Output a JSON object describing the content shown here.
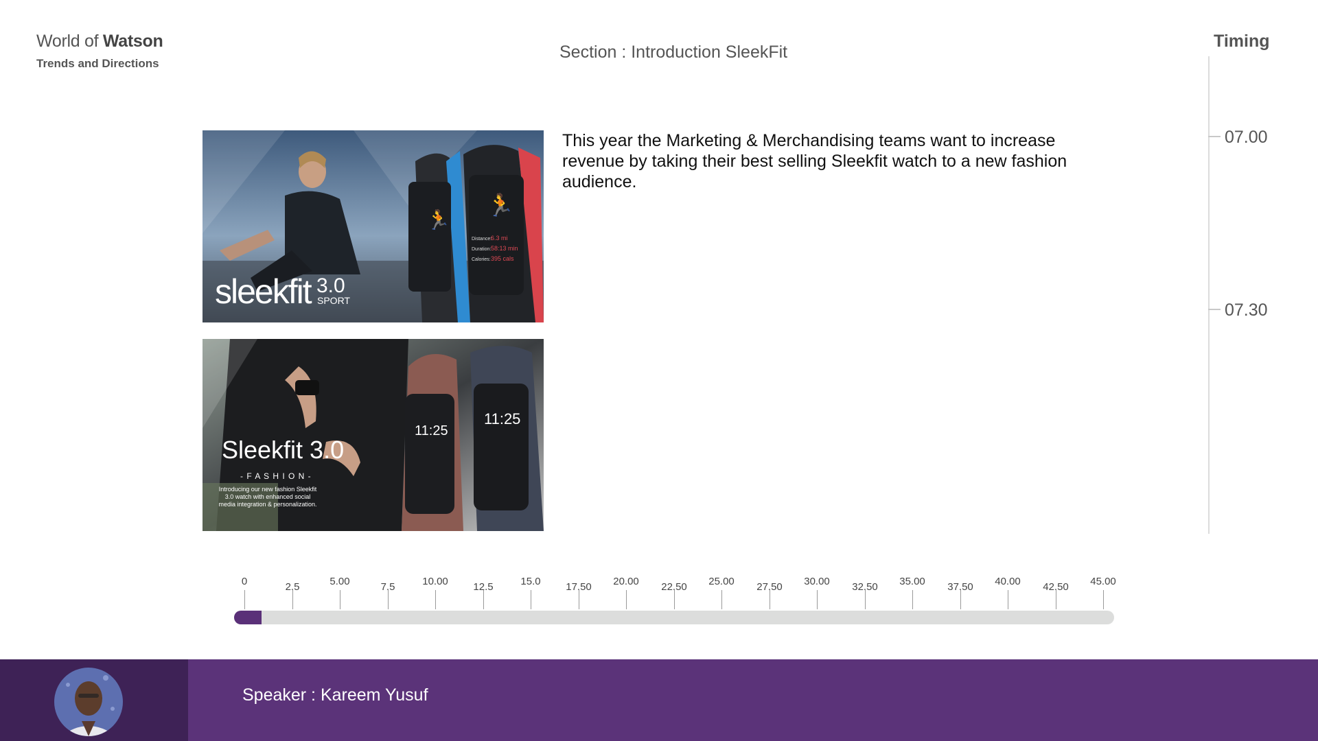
{
  "brand": {
    "name_light": "World of",
    "name_bold": "Watson",
    "subtitle": "Trends and Directions"
  },
  "section": {
    "title": "Section : Introduction SleekFit"
  },
  "timing": {
    "title": "Timing",
    "marks": [
      "07.00",
      "07.30"
    ]
  },
  "images": [
    {
      "brand": "sleekfit",
      "version": "3.0",
      "variant": "SPORT",
      "watch_stats": {
        "distance_label": "Distance:",
        "distance": "6.3 mi",
        "duration_label": "Duration:",
        "duration": "58:13 min",
        "calories_label": "Calories:",
        "calories": "395 cals"
      }
    },
    {
      "brand": "Sleekfit 3.0",
      "variant": "- F A S H I O N -",
      "caption": "Introducing our new fashion Sleekfit 3.0 watch with enhanced social media integration & personalization.",
      "watch_time": "11:25"
    }
  ],
  "content": {
    "paragraph": "This year the Marketing & Merchandising teams want to increase revenue by taking their best selling Sleekfit watch to a new fashion audience."
  },
  "timeline": {
    "labels": [
      "0",
      "2.5",
      "5.00",
      "7.5",
      "10.00",
      "12.5",
      "15.0",
      "17.50",
      "20.00",
      "22.50",
      "25.00",
      "27.50",
      "30.00",
      "32.50",
      "35.00",
      "37.50",
      "40.00",
      "42.50",
      "45.00"
    ],
    "min": 0,
    "max": 45,
    "progress": 0.6,
    "colors": {
      "fill": "#5a3078",
      "track": "#dcdddc"
    }
  },
  "footer": {
    "speaker": "Speaker : Kareem Yusuf"
  }
}
